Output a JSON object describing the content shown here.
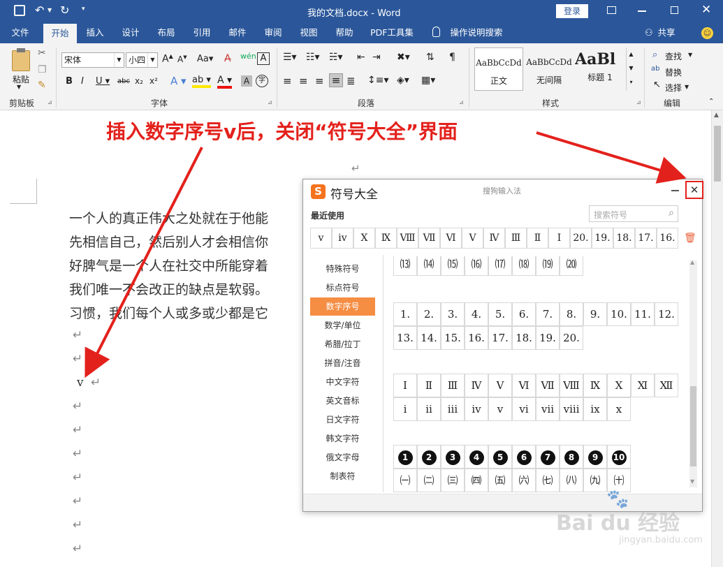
{
  "titlebar": {
    "doc_title": "我的文档.docx  -  Word",
    "login": "登录"
  },
  "tabs": [
    {
      "label": "文件"
    },
    {
      "label": "开始"
    },
    {
      "label": "插入"
    },
    {
      "label": "设计"
    },
    {
      "label": "布局"
    },
    {
      "label": "引用"
    },
    {
      "label": "邮件"
    },
    {
      "label": "审阅"
    },
    {
      "label": "视图"
    },
    {
      "label": "帮助"
    },
    {
      "label": "PDF工具集"
    },
    {
      "label": "操作说明搜索"
    }
  ],
  "share": "共享",
  "ribbon": {
    "paste": "粘贴",
    "clipboard": "剪贴板",
    "font_name": "宋体",
    "font_size": "小四",
    "font_group": "字体",
    "paragraph_group": "段落",
    "styles_group": "样式",
    "editing_group": "编辑",
    "styles": [
      {
        "preview": "AaBbCcDd",
        "name": "正文"
      },
      {
        "preview": "AaBbCcDd",
        "name": "无间隔"
      },
      {
        "preview": "AaBl",
        "name": "标题 1"
      }
    ],
    "find": "查找",
    "replace": "替换",
    "select": "选择"
  },
  "document": {
    "lines": [
      "一个人的真正伟大之处就在于他能",
      "先相信自己，然后别人才会相信你",
      "好脾气是一个人在社交中所能穿着",
      "我们唯一不会改正的缺点是软弱。",
      "习惯，我们每个人或多或少都是它"
    ],
    "inserted_char": "v",
    "return_mark": "↵"
  },
  "annotation": "插入数字序号ⅴ后，关闭“符号大全”界面",
  "symbol_panel": {
    "title": "符号大全",
    "source": "搜狗输入法",
    "recent_label": "最近使用",
    "search_placeholder": "搜索符号",
    "recent": [
      "ⅴ",
      "ⅳ",
      "Ⅹ",
      "Ⅸ",
      "Ⅷ",
      "Ⅶ",
      "Ⅵ",
      "Ⅴ",
      "Ⅳ",
      "Ⅲ",
      "Ⅱ",
      "Ⅰ",
      "20.",
      "19.",
      "18.",
      "17.",
      "16."
    ],
    "categories": [
      "特殊符号",
      "标点符号",
      "数字序号",
      "数学/单位",
      "希腊/拉丁",
      "拼音/注音",
      "中文字符",
      "英文音标",
      "日文字符",
      "韩文字符",
      "俄文字母",
      "制表符"
    ],
    "selected_category": "数字序号",
    "paren_row": [
      "⒀",
      "⒁",
      "⒂",
      "⒃",
      "⒄",
      "⒅",
      "⒆",
      "⒇"
    ],
    "dot_row1": [
      "1.",
      "2.",
      "3.",
      "4.",
      "5.",
      "6.",
      "7.",
      "8.",
      "9.",
      "10.",
      "11.",
      "12."
    ],
    "dot_row2": [
      "13.",
      "14.",
      "15.",
      "16.",
      "17.",
      "18.",
      "19.",
      "20."
    ],
    "roman_upper": [
      "Ⅰ",
      "Ⅱ",
      "Ⅲ",
      "Ⅳ",
      "Ⅴ",
      "Ⅵ",
      "Ⅶ",
      "Ⅷ",
      "Ⅸ",
      "Ⅹ",
      "Ⅺ",
      "Ⅻ"
    ],
    "roman_lower": [
      "ⅰ",
      "ⅱ",
      "ⅲ",
      "ⅳ",
      "ⅴ",
      "ⅵ",
      "ⅶ",
      "ⅷ",
      "ⅸ",
      "ⅹ"
    ],
    "circled": [
      "1",
      "2",
      "3",
      "4",
      "5",
      "6",
      "7",
      "8",
      "9",
      "10"
    ],
    "paren_cn": [
      "㈠",
      "㈡",
      "㈢",
      "㈣",
      "㈤",
      "㈥",
      "㈦",
      "㈧",
      "㈨",
      "㈩"
    ]
  },
  "watermark": {
    "brand": "Bai du 经验",
    "url": "jingyan.baidu.com"
  },
  "colors": {
    "word_blue": "#2b579a",
    "accent_orange": "#f58d43",
    "annotation_red": "#e3211c"
  }
}
